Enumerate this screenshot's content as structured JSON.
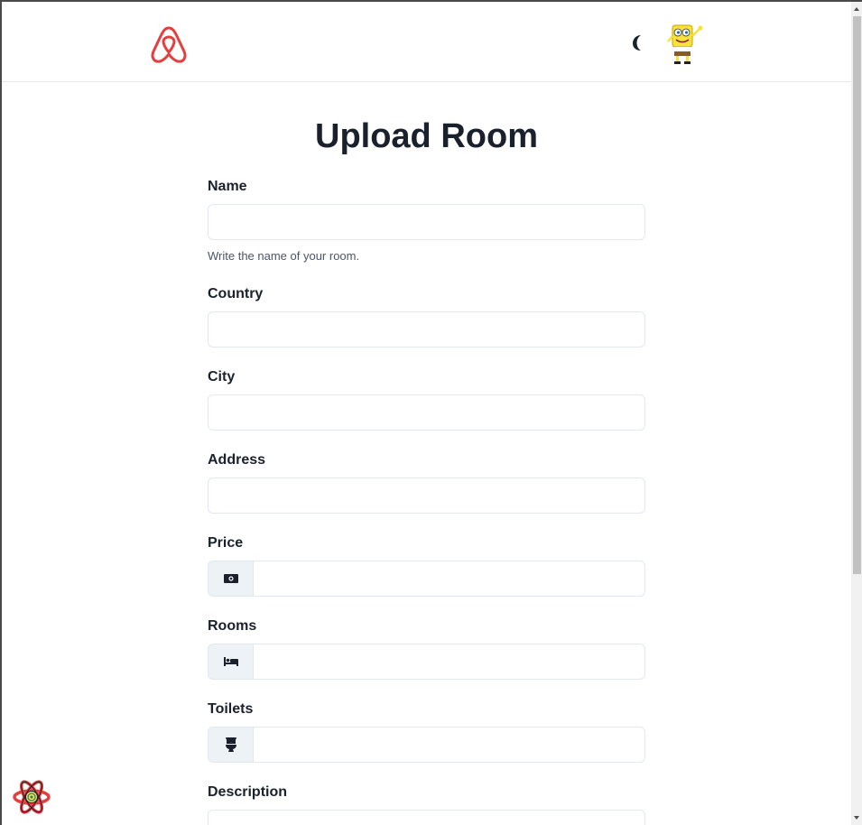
{
  "header": {
    "logo_icon": "airbnb-logo-icon",
    "theme_toggle_icon": "moon-icon",
    "avatar_icon": "spongebob-avatar",
    "brand_color": "#e53e3e"
  },
  "form": {
    "title": "Upload Room",
    "name": {
      "label": "Name",
      "value": "",
      "helper": "Write the name of your room."
    },
    "country": {
      "label": "Country",
      "value": ""
    },
    "city": {
      "label": "City",
      "value": ""
    },
    "address": {
      "label": "Address",
      "value": ""
    },
    "price": {
      "label": "Price",
      "value": "",
      "icon": "money-bill-icon"
    },
    "rooms": {
      "label": "Rooms",
      "value": "",
      "icon": "bed-icon"
    },
    "toilets": {
      "label": "Toilets",
      "value": "",
      "icon": "toilet-icon"
    },
    "description": {
      "label": "Description",
      "value": ""
    }
  },
  "devtools": {
    "icon": "react-query-devtools-icon"
  }
}
